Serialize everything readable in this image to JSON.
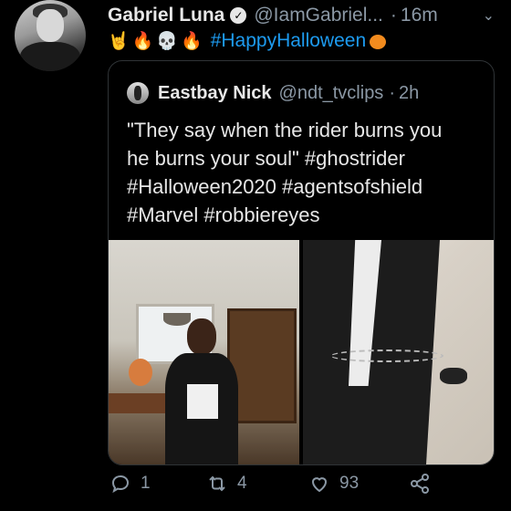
{
  "tweet": {
    "author_name": "Gabriel Luna",
    "handle": "@IamGabriel...",
    "dot": "·",
    "time": "16m",
    "emojis": [
      "🤘",
      "🔥",
      "💀",
      "🔥"
    ],
    "hashtag": "#HappyHalloween"
  },
  "quote": {
    "author_name": "Eastbay Nick",
    "handle": "@ndt_tvclips",
    "dot": "·",
    "time": "2h",
    "lines": [
      "\"They say when the rider burns you",
      "he burns your soul\" #ghostrider",
      "#Halloween2020 #agentsofshield",
      "#Marvel #robbiereyes"
    ]
  },
  "actions": {
    "reply_count": "1",
    "retweet_count": "4",
    "like_count": "93"
  },
  "colors": {
    "background": "#000000",
    "link": "#1d9bf0",
    "muted": "#8b98a5"
  }
}
